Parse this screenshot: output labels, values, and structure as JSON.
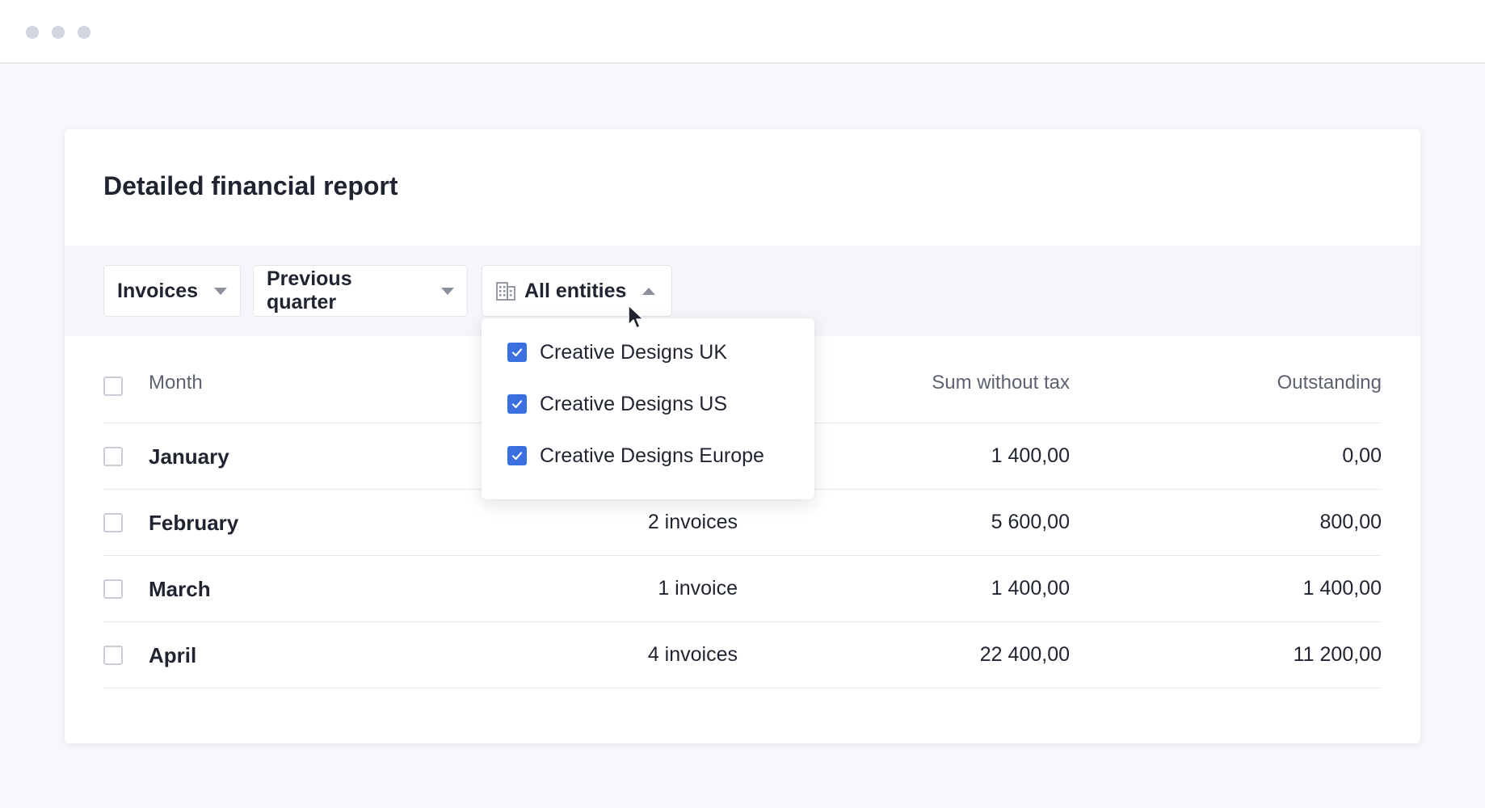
{
  "window": {},
  "card": {
    "title": "Detailed financial report"
  },
  "filters": {
    "type_label": "Invoices",
    "period_label": "Previous quarter",
    "entities_label": "All entities"
  },
  "entities_dropdown": {
    "items": [
      {
        "label": "Creative Designs UK",
        "checked": true
      },
      {
        "label": "Creative Designs US",
        "checked": true
      },
      {
        "label": "Creative Designs Europe",
        "checked": true
      }
    ]
  },
  "table": {
    "headers": {
      "month": "Month",
      "sum": "Sum without tax",
      "outstanding": "Outstanding"
    },
    "rows": [
      {
        "month": "January",
        "count": "",
        "sum": "1 400,00",
        "outstanding": "0,00"
      },
      {
        "month": "February",
        "count": "2 invoices",
        "sum": "5 600,00",
        "outstanding": "800,00"
      },
      {
        "month": "March",
        "count": "1 invoice",
        "sum": "1 400,00",
        "outstanding": "1 400,00"
      },
      {
        "month": "April",
        "count": "4 invoices",
        "sum": "22 400,00",
        "outstanding": "11 200,00"
      }
    ]
  },
  "colors": {
    "accent": "#3b6fe0",
    "background": "#f7f8fb"
  }
}
